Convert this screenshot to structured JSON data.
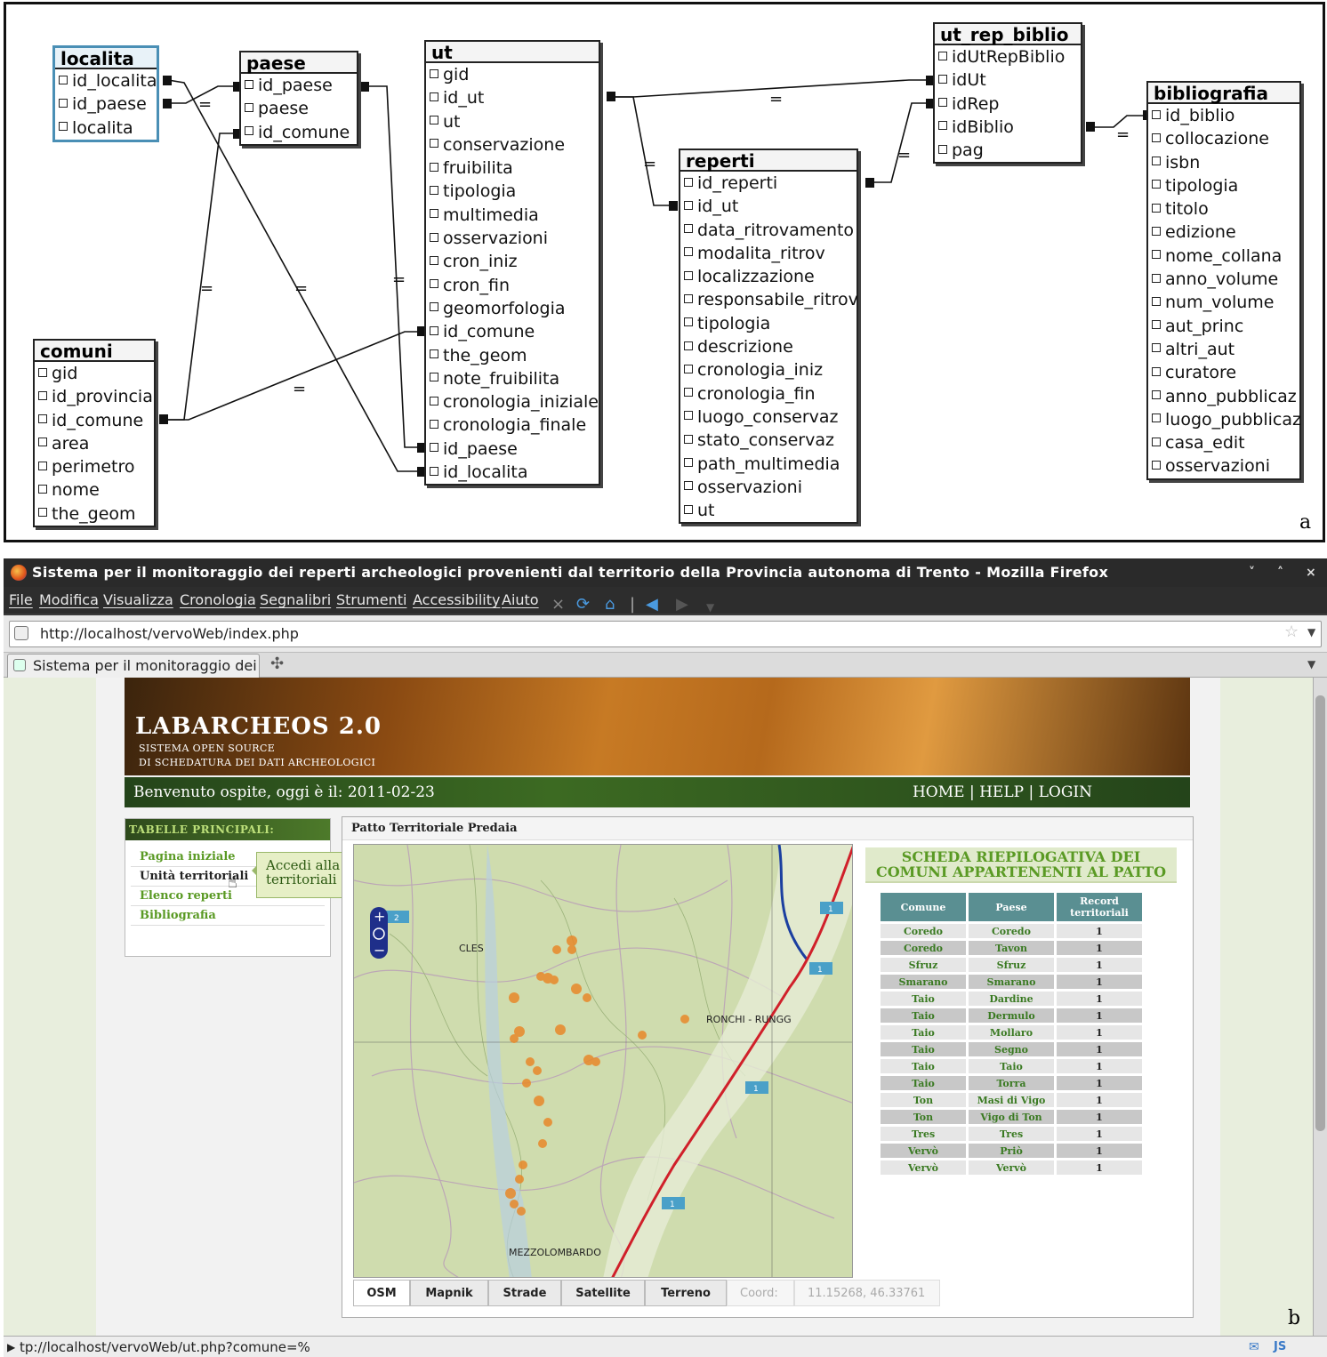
{
  "erd": {
    "panel_label": "a",
    "tables": [
      {
        "id": "localita",
        "name": "localita",
        "fields": [
          "id_localita",
          "id_paese",
          "localita"
        ]
      },
      {
        "id": "paese",
        "name": "paese",
        "fields": [
          "id_paese",
          "paese",
          "id_comune"
        ]
      },
      {
        "id": "comuni",
        "name": "comuni",
        "fields": [
          "gid",
          "id_provincia",
          "id_comune",
          "area",
          "perimetro",
          "nome",
          "the_geom"
        ]
      },
      {
        "id": "ut",
        "name": "ut",
        "fields": [
          "gid",
          "id_ut",
          "ut",
          "conservazione",
          "fruibilita",
          "tipologia",
          "multimedia",
          "osservazioni",
          "cron_iniz",
          "cron_fin",
          "geomorfologia",
          "id_comune",
          "the_geom",
          "note_fruibilita",
          "cronologia_iniziale",
          "cronologia_finale",
          "id_paese",
          "id_localita"
        ]
      },
      {
        "id": "reperti",
        "name": "reperti",
        "fields": [
          "id_reperti",
          "id_ut",
          "data_ritrovamento",
          "modalita_ritrov",
          "localizzazione",
          "responsabile_ritrov",
          "tipologia",
          "descrizione",
          "cronologia_iniz",
          "cronologia_fin",
          "luogo_conservaz",
          "stato_conservaz",
          "path_multimedia",
          "osservazioni",
          "ut"
        ]
      },
      {
        "id": "ut_rep_biblio",
        "name": "ut_rep_biblio",
        "fields": [
          "idUtRepBiblio",
          "idUt",
          "idRep",
          "idBiblio",
          "pag"
        ]
      },
      {
        "id": "bibliografia",
        "name": "bibliografia",
        "fields": [
          "id_biblio",
          "collocazione",
          "isbn",
          "tipologia",
          "titolo",
          "edizione",
          "nome_collana",
          "anno_volume",
          "num_volume",
          "aut_princ",
          "altri_aut",
          "curatore",
          "anno_pubblicaz",
          "luogo_pubblicaz",
          "casa_edit",
          "osservazioni"
        ]
      }
    ],
    "relation_symbol": "="
  },
  "browser": {
    "panel_label": "b",
    "window_title": "Sistema per il monitoraggio dei reperti archeologici provenienti dal territorio della Provincia autonoma di Trento - Mozilla Firefox",
    "window_controls": [
      "˅",
      "˄",
      "×"
    ],
    "menu": [
      "File",
      "Modifica",
      "Visualizza",
      "Cronologia",
      "Segnalibri",
      "Strumenti",
      "Accessibility",
      "Aiuto"
    ],
    "url": "http://localhost/vervoWeb/index.php",
    "tab_title": "Sistema per il monitoraggio dei ...",
    "new_tab_symbol": "✣",
    "status_text": "tp://localhost/vervoWeb/ut.php?comune=%",
    "status_js": "JS"
  },
  "site": {
    "logo_title": "LABARCHEOS 2.0",
    "logo_sub1": "SISTEMA OPEN SOURCE",
    "logo_sub2": "DI SCHEDATURA DEI DATI ARCHEOLOGICI",
    "welcome": "Benvenuto ospite, oggi è il: 2011-02-23",
    "nav": "HOME | HELP | LOGIN",
    "sidebar_title": "TABELLE PRINCIPALI:",
    "sidebar_items": [
      "Pagina iniziale",
      "Unità territoriali",
      "Elenco reperti",
      "Bibliografia"
    ],
    "tooltip": "Accedi alla pagina delle Unità territoriali",
    "main_title": "Patto Territoriale Predaia",
    "map": {
      "labels": [
        "CLES",
        "RONCHI - RUNGG",
        "MEZZOLOMBARDO"
      ],
      "road_badges": [
        "1",
        "1",
        "1",
        "1",
        "2"
      ],
      "zoom_in": "+",
      "zoom_out": "−",
      "tabs": [
        "OSM",
        "Mapnik",
        "Strade",
        "Satellite",
        "Terreno"
      ],
      "active_tab": "OSM",
      "coord_label": "Coord:",
      "coord_value": "11.15268, 46.33761"
    },
    "summary_title": "SCHEDA RIEPILOGATIVA DEI COMUNI APPARTENENTI AL PATTO",
    "summary_headers": [
      "Comune",
      "Paese",
      "Record territoriali"
    ],
    "summary_rows": [
      [
        "Coredo",
        "Coredo",
        "1"
      ],
      [
        "Coredo",
        "Tavon",
        "1"
      ],
      [
        "Sfruz",
        "Sfruz",
        "1"
      ],
      [
        "Smarano",
        "Smarano",
        "1"
      ],
      [
        "Taio",
        "Dardine",
        "1"
      ],
      [
        "Taio",
        "Dermulo",
        "1"
      ],
      [
        "Taio",
        "Mollaro",
        "1"
      ],
      [
        "Taio",
        "Segno",
        "1"
      ],
      [
        "Taio",
        "Taio",
        "1"
      ],
      [
        "Taio",
        "Torra",
        "1"
      ],
      [
        "Ton",
        "Masi di Vigo",
        "1"
      ],
      [
        "Ton",
        "Vigo di Ton",
        "1"
      ],
      [
        "Tres",
        "Tres",
        "1"
      ],
      [
        "Vervò",
        "Priò",
        "1"
      ],
      [
        "Vervò",
        "Vervò",
        "1"
      ]
    ]
  }
}
